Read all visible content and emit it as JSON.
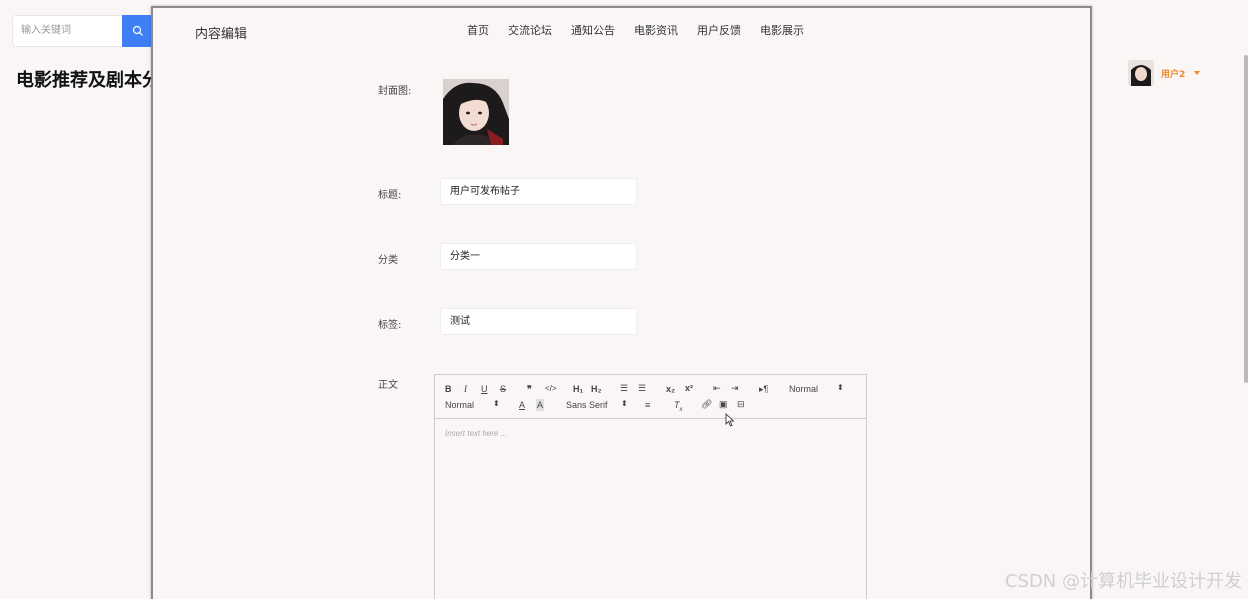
{
  "search": {
    "placeholder": "输入关键词"
  },
  "site_title": "电影推荐及剧本分析系统",
  "user": {
    "name": "用户2"
  },
  "panel": {
    "title": "内容编辑",
    "nav": [
      "首页",
      "交流论坛",
      "通知公告",
      "电影资讯",
      "用户反馈",
      "电影展示"
    ]
  },
  "form": {
    "cover_label": "封面图:",
    "title_label": "标题:",
    "title_value": "用户可发布帖子",
    "category_label": "分类",
    "category_value": "分类一",
    "tags_label": "标签:",
    "tags_value": "测试",
    "body_label": "正文"
  },
  "editor": {
    "header_select": "Normal",
    "size_select": "Normal",
    "font_select": "Sans Serif",
    "placeholder": "Insert text here ..."
  },
  "watermark": "CSDN @计算机毕业设计开发",
  "colors": {
    "accent": "#3f7ff6",
    "user": "#f08a24"
  }
}
